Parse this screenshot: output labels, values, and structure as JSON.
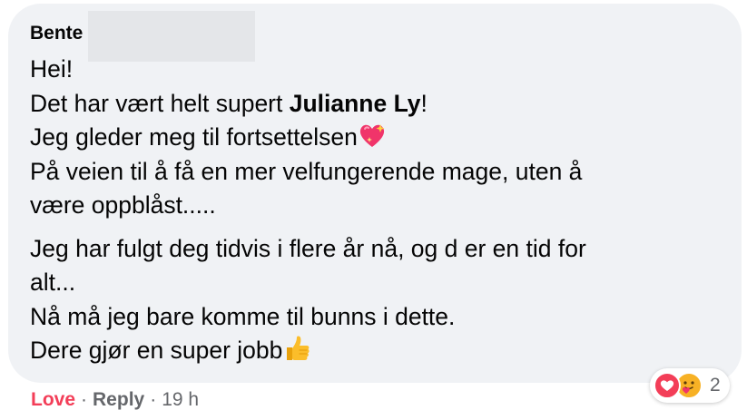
{
  "comment": {
    "author": "Bente",
    "paragraphs": [
      {
        "lines": [
          {
            "text": "Hei!"
          },
          {
            "pre": "Det har vært helt supert ",
            "mention": "Julianne Ly",
            "post": "!"
          },
          {
            "text": "Jeg gleder meg til fortsettelsen",
            "emoji": "sparkling-heart-icon"
          },
          {
            "text": "På veien til å få en mer velfungerende mage, uten å"
          },
          {
            "text": "være oppblåst....."
          }
        ]
      },
      {
        "lines": [
          {
            "text": "Jeg har fulgt deg tidvis i flere år nå, og d er en tid for"
          },
          {
            "text": "alt..."
          },
          {
            "text": "Nå må jeg bare komme til bunns i dette."
          },
          {
            "text": "Dere gjør en super jobb",
            "emoji": "thumbs-up-icon"
          }
        ]
      }
    ]
  },
  "footer": {
    "love_label": "Love",
    "separator": "·",
    "reply_label": "Reply",
    "time": "19 h"
  },
  "reactions": {
    "count": "2",
    "icons": [
      "love-reaction-icon",
      "care-reaction-icon"
    ]
  },
  "colors": {
    "bubble_bg": "#f0f2f5",
    "love": "#f33e58",
    "meta": "#65676b",
    "text": "#050505"
  }
}
